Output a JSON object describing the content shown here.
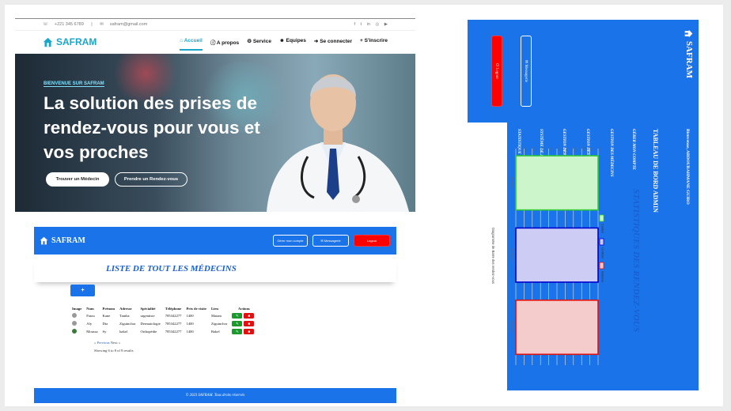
{
  "landing": {
    "contact": {
      "phone": "+221 345 6789",
      "email": "safram@gmail.com"
    },
    "social_icons": [
      "facebook-icon",
      "twitter-icon",
      "linkedin-icon",
      "instagram-icon",
      "youtube-icon"
    ],
    "brand": "SAFRAM",
    "menu": [
      {
        "label": "Accueil",
        "icon": "home-icon",
        "active": true
      },
      {
        "label": "A propos",
        "icon": "info-icon"
      },
      {
        "label": "Service",
        "icon": "cogs-icon"
      },
      {
        "label": "Equipes",
        "icon": "users-icon"
      },
      {
        "label": "Se connecter",
        "icon": "login-icon"
      },
      {
        "label": "S'inscrire",
        "icon": "user-plus-icon"
      }
    ],
    "hero": {
      "tagline": "BIENVENUE SUR SAFRAM",
      "title": "La solution des prises de rendez-vous pour vous et vos proches",
      "btn_primary": "Trouver un Médecin",
      "btn_secondary": "Prendre un Rendez-vous"
    }
  },
  "admin_list": {
    "brand": "SAFRAM",
    "header_buttons": {
      "account": "Gérer mon compte",
      "messages": "Messagerie",
      "logout": "Logout"
    },
    "title": "LISTE DE TOUT LES MÉDECINS",
    "add_label": "+",
    "columns": [
      "Image",
      "Nom",
      "Prénom",
      "Adresse",
      "Spécialité",
      "Téléphone",
      "Prix de visite",
      "Lieu",
      "Actions"
    ],
    "rows": [
      [
        "",
        "Fatou",
        "Kane",
        "Tamba",
        "urgentiste",
        "785342277",
        "1400",
        "Matam"
      ],
      [
        "",
        "Aly",
        "Dia",
        "Ziguinchor",
        "Dermatologie",
        "785342277",
        "1400",
        "Ziguinchor"
      ],
      [
        "",
        "Moussa",
        "Sy",
        "bakel",
        "Orthopédie",
        "785342277",
        "1400",
        "Bakel"
      ]
    ],
    "pager": {
      "prev": "« Previous",
      "next": "Next »"
    },
    "showing": "Showing 6 to 8 of 8 results",
    "footer": "© 2023  SAFRAM. Tous droits réservés"
  },
  "stats_dashboard": {
    "brand": "SAFRAM",
    "side_buttons": {
      "messages": "Messagerie",
      "logout": "Logout"
    },
    "greeting": "Bienvenue,  ABDOURAHMANE GUIRO",
    "dashboard_title": "TABLEAU DE BORD ADMIN",
    "menu": [
      "GÉRER MON COMPTE",
      "GESTION DES MÉDECINS",
      "GESTION DES SPÉCIALITÉS",
      "GESTION DES COMPTES",
      "SYSTÈME DE FACTURATION",
      "STATISTIQUE"
    ],
    "stat_title": "STATISTIQUES DES RENDEZ-VOUS"
  },
  "chart_data": {
    "type": "bar",
    "title": "Diagramme de Barre des rendez-vous",
    "categories": [
      "Cardiolo",
      "Dr.Morin",
      "Babacar"
    ],
    "series": [
      {
        "name": "Cardiol",
        "values": [
          1
        ]
      },
      {
        "name": "Dr.Morin",
        "values": [
          1
        ]
      },
      {
        "name": "Babacar",
        "values": [
          1
        ]
      }
    ],
    "values": [
      1,
      1,
      1
    ],
    "ylim": [
      0,
      1
    ],
    "colors": [
      "#33cc33",
      "#0000cc",
      "#dd1111"
    ],
    "fills": [
      "#ccf5cc",
      "#ccccf5",
      "#f5cccc"
    ],
    "legend_position": "top",
    "grid": true
  }
}
